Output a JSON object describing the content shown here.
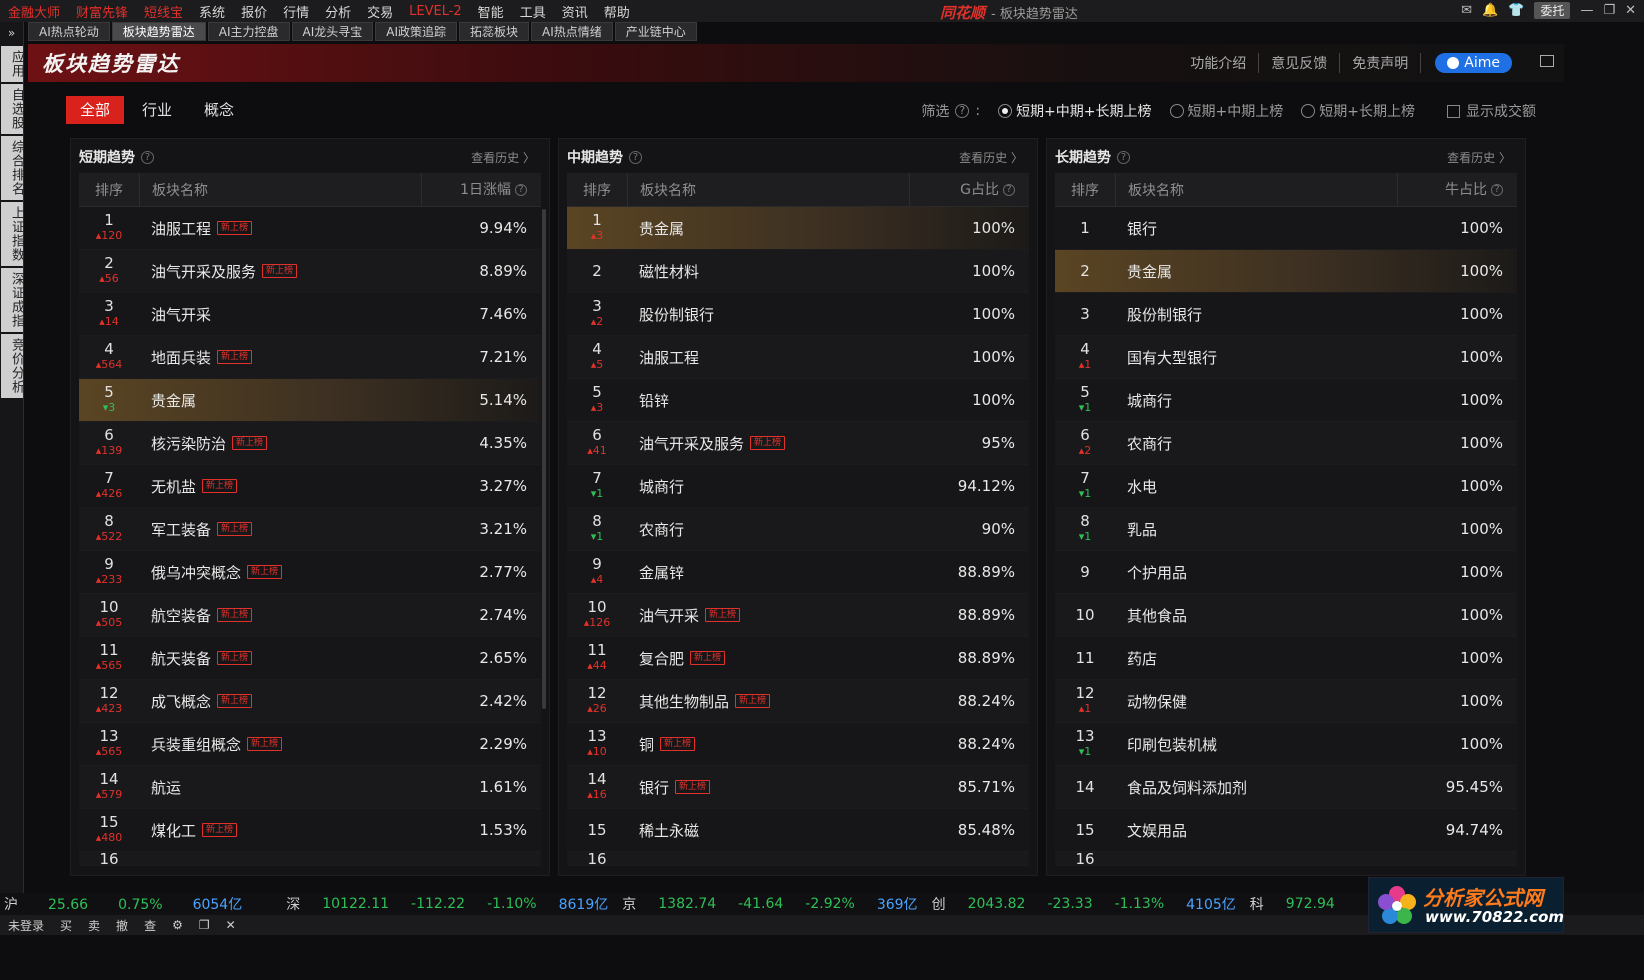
{
  "menubar": {
    "items": [
      "金融大师",
      "财富先锋",
      "短线宝",
      "系统",
      "报价",
      "行情",
      "分析",
      "交易",
      "LEVEL-2",
      "智能",
      "工具",
      "资讯",
      "帮助"
    ],
    "app_brand": "同花顺",
    "app_title": "- 板块趋势雷达",
    "entrust_label": "委托"
  },
  "subtabs": [
    "AI热点轮动",
    "板块趋势雷达",
    "AI主力控盘",
    "AI龙头寻宝",
    "AI政策追踪",
    "拓蕊板块",
    "AI热点情绪",
    "产业链中心"
  ],
  "leftbar": {
    "top": "»",
    "items": [
      "应用",
      "自选股",
      "综合排名",
      "上证指数",
      "深证成指",
      "竞价分析"
    ]
  },
  "header": {
    "title": "板块趋势雷达",
    "links": [
      "功能介绍",
      "意见反馈",
      "免责声明"
    ],
    "aime": "Aime"
  },
  "filters": {
    "segments": [
      "全部",
      "行业",
      "概念"
    ],
    "label": "筛选",
    "options": [
      "短期+中期+长期上榜",
      "短期+中期上榜",
      "短期+长期上榜"
    ],
    "selected_index": 0,
    "checkbox_label": "显示成交额"
  },
  "new_badge": "新上榜",
  "panels": [
    {
      "title": "短期趋势",
      "history": "查看历史 〉",
      "headers": [
        "排序",
        "板块名称",
        "1日涨幅"
      ],
      "rows": [
        {
          "rank": "1",
          "chg": "120",
          "dir": "up",
          "name": "油服工程",
          "new": true,
          "value": "9.94%"
        },
        {
          "rank": "2",
          "chg": "56",
          "dir": "up",
          "name": "油气开采及服务",
          "new": true,
          "value": "8.89%"
        },
        {
          "rank": "3",
          "chg": "14",
          "dir": "up",
          "name": "油气开采",
          "new": false,
          "value": "7.46%"
        },
        {
          "rank": "4",
          "chg": "564",
          "dir": "up",
          "name": "地面兵装",
          "new": true,
          "value": "7.21%"
        },
        {
          "rank": "5",
          "chg": "3",
          "dir": "dn",
          "name": "贵金属",
          "new": false,
          "value": "5.14%",
          "hl": true
        },
        {
          "rank": "6",
          "chg": "139",
          "dir": "up",
          "name": "核污染防治",
          "new": true,
          "value": "4.35%"
        },
        {
          "rank": "7",
          "chg": "426",
          "dir": "up",
          "name": "无机盐",
          "new": true,
          "value": "3.27%"
        },
        {
          "rank": "8",
          "chg": "522",
          "dir": "up",
          "name": "军工装备",
          "new": true,
          "value": "3.21%"
        },
        {
          "rank": "9",
          "chg": "233",
          "dir": "up",
          "name": "俄乌冲突概念",
          "new": true,
          "value": "2.77%"
        },
        {
          "rank": "10",
          "chg": "505",
          "dir": "up",
          "name": "航空装备",
          "new": true,
          "value": "2.74%"
        },
        {
          "rank": "11",
          "chg": "565",
          "dir": "up",
          "name": "航天装备",
          "new": true,
          "value": "2.65%"
        },
        {
          "rank": "12",
          "chg": "423",
          "dir": "up",
          "name": "成飞概念",
          "new": true,
          "value": "2.42%"
        },
        {
          "rank": "13",
          "chg": "565",
          "dir": "up",
          "name": "兵装重组概念",
          "new": true,
          "value": "2.29%"
        },
        {
          "rank": "14",
          "chg": "579",
          "dir": "up",
          "name": "航运",
          "new": false,
          "value": "1.61%"
        },
        {
          "rank": "15",
          "chg": "480",
          "dir": "up",
          "name": "煤化工",
          "new": true,
          "value": "1.53%"
        },
        {
          "rank": "16",
          "chg": "",
          "dir": "up",
          "name": "",
          "new": false,
          "value": "",
          "cut": true
        }
      ]
    },
    {
      "title": "中期趋势",
      "history": "查看历史 〉",
      "headers": [
        "排序",
        "板块名称",
        "G占比"
      ],
      "rows": [
        {
          "rank": "1",
          "chg": "3",
          "dir": "up",
          "name": "贵金属",
          "new": false,
          "value": "100%",
          "hl": true
        },
        {
          "rank": "2",
          "chg": "",
          "dir": "up",
          "name": "磁性材料",
          "new": false,
          "value": "100%"
        },
        {
          "rank": "3",
          "chg": "2",
          "dir": "up",
          "name": "股份制银行",
          "new": false,
          "value": "100%"
        },
        {
          "rank": "4",
          "chg": "5",
          "dir": "up",
          "name": "油服工程",
          "new": false,
          "value": "100%"
        },
        {
          "rank": "5",
          "chg": "3",
          "dir": "up",
          "name": "铅锌",
          "new": false,
          "value": "100%"
        },
        {
          "rank": "6",
          "chg": "41",
          "dir": "up",
          "name": "油气开采及服务",
          "new": true,
          "value": "95%"
        },
        {
          "rank": "7",
          "chg": "1",
          "dir": "dn",
          "name": "城商行",
          "new": false,
          "value": "94.12%"
        },
        {
          "rank": "8",
          "chg": "1",
          "dir": "dn",
          "name": "农商行",
          "new": false,
          "value": "90%"
        },
        {
          "rank": "9",
          "chg": "4",
          "dir": "up",
          "name": "金属锌",
          "new": false,
          "value": "88.89%"
        },
        {
          "rank": "10",
          "chg": "126",
          "dir": "up",
          "name": "油气开采",
          "new": true,
          "value": "88.89%"
        },
        {
          "rank": "11",
          "chg": "44",
          "dir": "up",
          "name": "复合肥",
          "new": true,
          "value": "88.89%"
        },
        {
          "rank": "12",
          "chg": "26",
          "dir": "up",
          "name": "其他生物制品",
          "new": true,
          "value": "88.24%"
        },
        {
          "rank": "13",
          "chg": "10",
          "dir": "up",
          "name": "铜",
          "new": true,
          "value": "88.24%"
        },
        {
          "rank": "14",
          "chg": "16",
          "dir": "up",
          "name": "银行",
          "new": true,
          "value": "85.71%"
        },
        {
          "rank": "15",
          "chg": "",
          "dir": "up",
          "name": "稀土永磁",
          "new": false,
          "value": "85.48%"
        },
        {
          "rank": "16",
          "chg": "",
          "dir": "up",
          "name": "",
          "new": false,
          "value": "",
          "cut": true
        }
      ]
    },
    {
      "title": "长期趋势",
      "history": "查看历史 〉",
      "headers": [
        "排序",
        "板块名称",
        "牛占比"
      ],
      "rows": [
        {
          "rank": "1",
          "chg": "",
          "dir": "up",
          "name": "银行",
          "new": false,
          "value": "100%"
        },
        {
          "rank": "2",
          "chg": "",
          "dir": "up",
          "name": "贵金属",
          "new": false,
          "value": "100%",
          "hl": true
        },
        {
          "rank": "3",
          "chg": "",
          "dir": "up",
          "name": "股份制银行",
          "new": false,
          "value": "100%"
        },
        {
          "rank": "4",
          "chg": "1",
          "dir": "up",
          "name": "国有大型银行",
          "new": false,
          "value": "100%"
        },
        {
          "rank": "5",
          "chg": "1",
          "dir": "dn",
          "name": "城商行",
          "new": false,
          "value": "100%"
        },
        {
          "rank": "6",
          "chg": "2",
          "dir": "up",
          "name": "农商行",
          "new": false,
          "value": "100%"
        },
        {
          "rank": "7",
          "chg": "1",
          "dir": "dn",
          "name": "水电",
          "new": false,
          "value": "100%"
        },
        {
          "rank": "8",
          "chg": "1",
          "dir": "dn",
          "name": "乳品",
          "new": false,
          "value": "100%"
        },
        {
          "rank": "9",
          "chg": "",
          "dir": "up",
          "name": "个护用品",
          "new": false,
          "value": "100%"
        },
        {
          "rank": "10",
          "chg": "",
          "dir": "up",
          "name": "其他食品",
          "new": false,
          "value": "100%"
        },
        {
          "rank": "11",
          "chg": "",
          "dir": "up",
          "name": "药店",
          "new": false,
          "value": "100%"
        },
        {
          "rank": "12",
          "chg": "1",
          "dir": "up",
          "name": "动物保健",
          "new": false,
          "value": "100%"
        },
        {
          "rank": "13",
          "chg": "1",
          "dir": "dn",
          "name": "印刷包装机械",
          "new": false,
          "value": "100%"
        },
        {
          "rank": "14",
          "chg": "",
          "dir": "up",
          "name": "食品及饲料添加剂",
          "new": false,
          "value": "95.45%"
        },
        {
          "rank": "15",
          "chg": "",
          "dir": "up",
          "name": "文娱用品",
          "new": false,
          "value": "94.74%"
        },
        {
          "rank": "16",
          "chg": "",
          "dir": "up",
          "name": "",
          "new": false,
          "value": "",
          "cut": true
        }
      ]
    }
  ],
  "ticker": [
    {
      "text": "深",
      "cls": "wh"
    },
    {
      "text": "10122.11",
      "cls": "gr"
    },
    {
      "text": "-112.22",
      "cls": "gr"
    },
    {
      "text": "-1.10%",
      "cls": "gr"
    },
    {
      "text": "8619亿",
      "cls": "bl"
    },
    {
      "text": "京",
      "cls": "wh"
    },
    {
      "text": "1382.74",
      "cls": "gr"
    },
    {
      "text": "-41.64",
      "cls": "gr"
    },
    {
      "text": "-2.92%",
      "cls": "gr"
    },
    {
      "text": "369亿",
      "cls": "bl"
    },
    {
      "text": "创",
      "cls": "wh"
    },
    {
      "text": "2043.82",
      "cls": "gr"
    },
    {
      "text": "-23.33",
      "cls": "gr"
    },
    {
      "text": "-1.13%",
      "cls": "gr"
    },
    {
      "text": "4105亿",
      "cls": "bl"
    },
    {
      "text": "科",
      "cls": "wh"
    },
    {
      "text": "972.94",
      "cls": "gr"
    }
  ],
  "ticker_prefix": [
    "沪",
    "25.66",
    "0.75%",
    "6054亿"
  ],
  "bottombar": [
    "未登录",
    "买",
    "卖",
    "撤",
    "查"
  ],
  "logo": {
    "title": "分析家公式网",
    "url": "www.70822.com"
  },
  "colors": {
    "accent_red": "#d9221c",
    "up": "#e0312b",
    "down": "#2fbf57",
    "highlight": "#5a4523"
  }
}
